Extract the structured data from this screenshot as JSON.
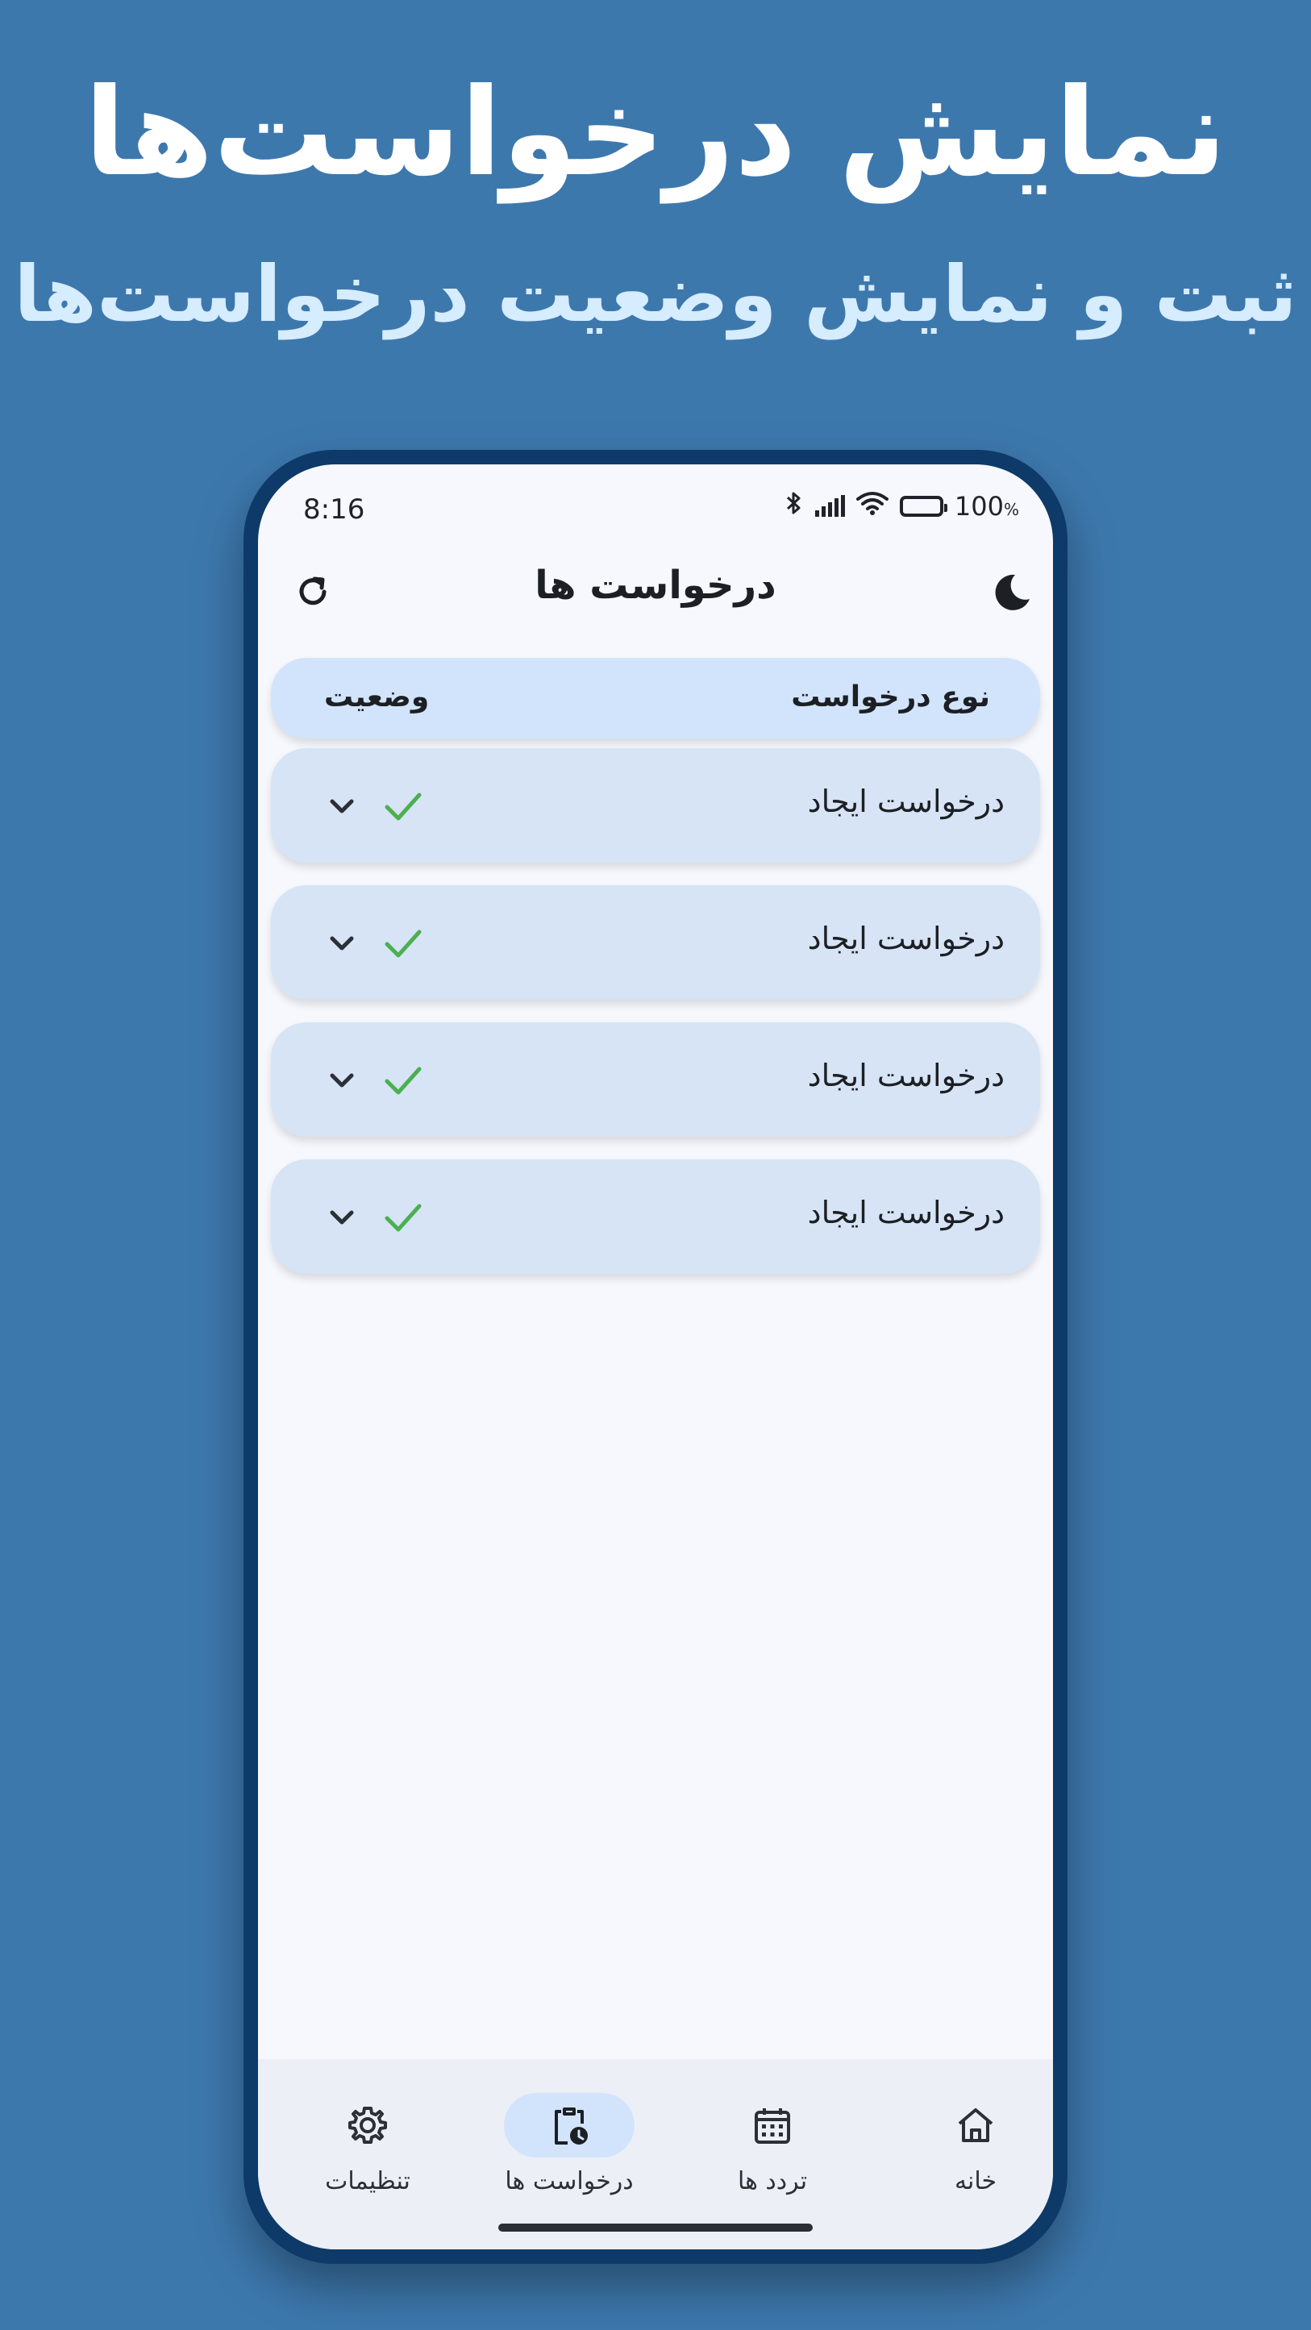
{
  "promo": {
    "title": "نمایش درخواست‌ها",
    "subtitle": "ثبت و نمایش وضعیت درخواست‌ها"
  },
  "status_bar": {
    "time": "8:16",
    "battery": "100",
    "battery_unit": "%",
    "icons": [
      "bluetooth-icon",
      "signal-icon",
      "wifi-icon",
      "battery-icon"
    ]
  },
  "app_bar": {
    "title": "درخواست ها",
    "left_icon": "refresh-icon",
    "right_icon": "dark-mode-moon-icon"
  },
  "table": {
    "header_type": "نوع درخواست",
    "header_status": "وضعیت",
    "rows": [
      {
        "label": "درخواست ایجاد",
        "status": "approved-check"
      },
      {
        "label": "درخواست ایجاد",
        "status": "approved-check"
      },
      {
        "label": "درخواست ایجاد",
        "status": "approved-check"
      },
      {
        "label": "درخواست ایجاد",
        "status": "approved-check"
      }
    ]
  },
  "bottom_nav": {
    "items": [
      {
        "label": "تنظیمات",
        "icon": "settings-gear-icon",
        "active": false
      },
      {
        "label": "درخواست ها",
        "icon": "clipboard-clock-icon",
        "active": true
      },
      {
        "label": "تردد ها",
        "icon": "calendar-icon",
        "active": false
      },
      {
        "label": "خانه",
        "icon": "home-icon",
        "active": false
      }
    ]
  },
  "colors": {
    "background": "#3d78ad",
    "phone_frame": "#0d3a68",
    "header_row": "#d2e4fb",
    "row": "#d6e4f5",
    "check": "#4caf50"
  }
}
